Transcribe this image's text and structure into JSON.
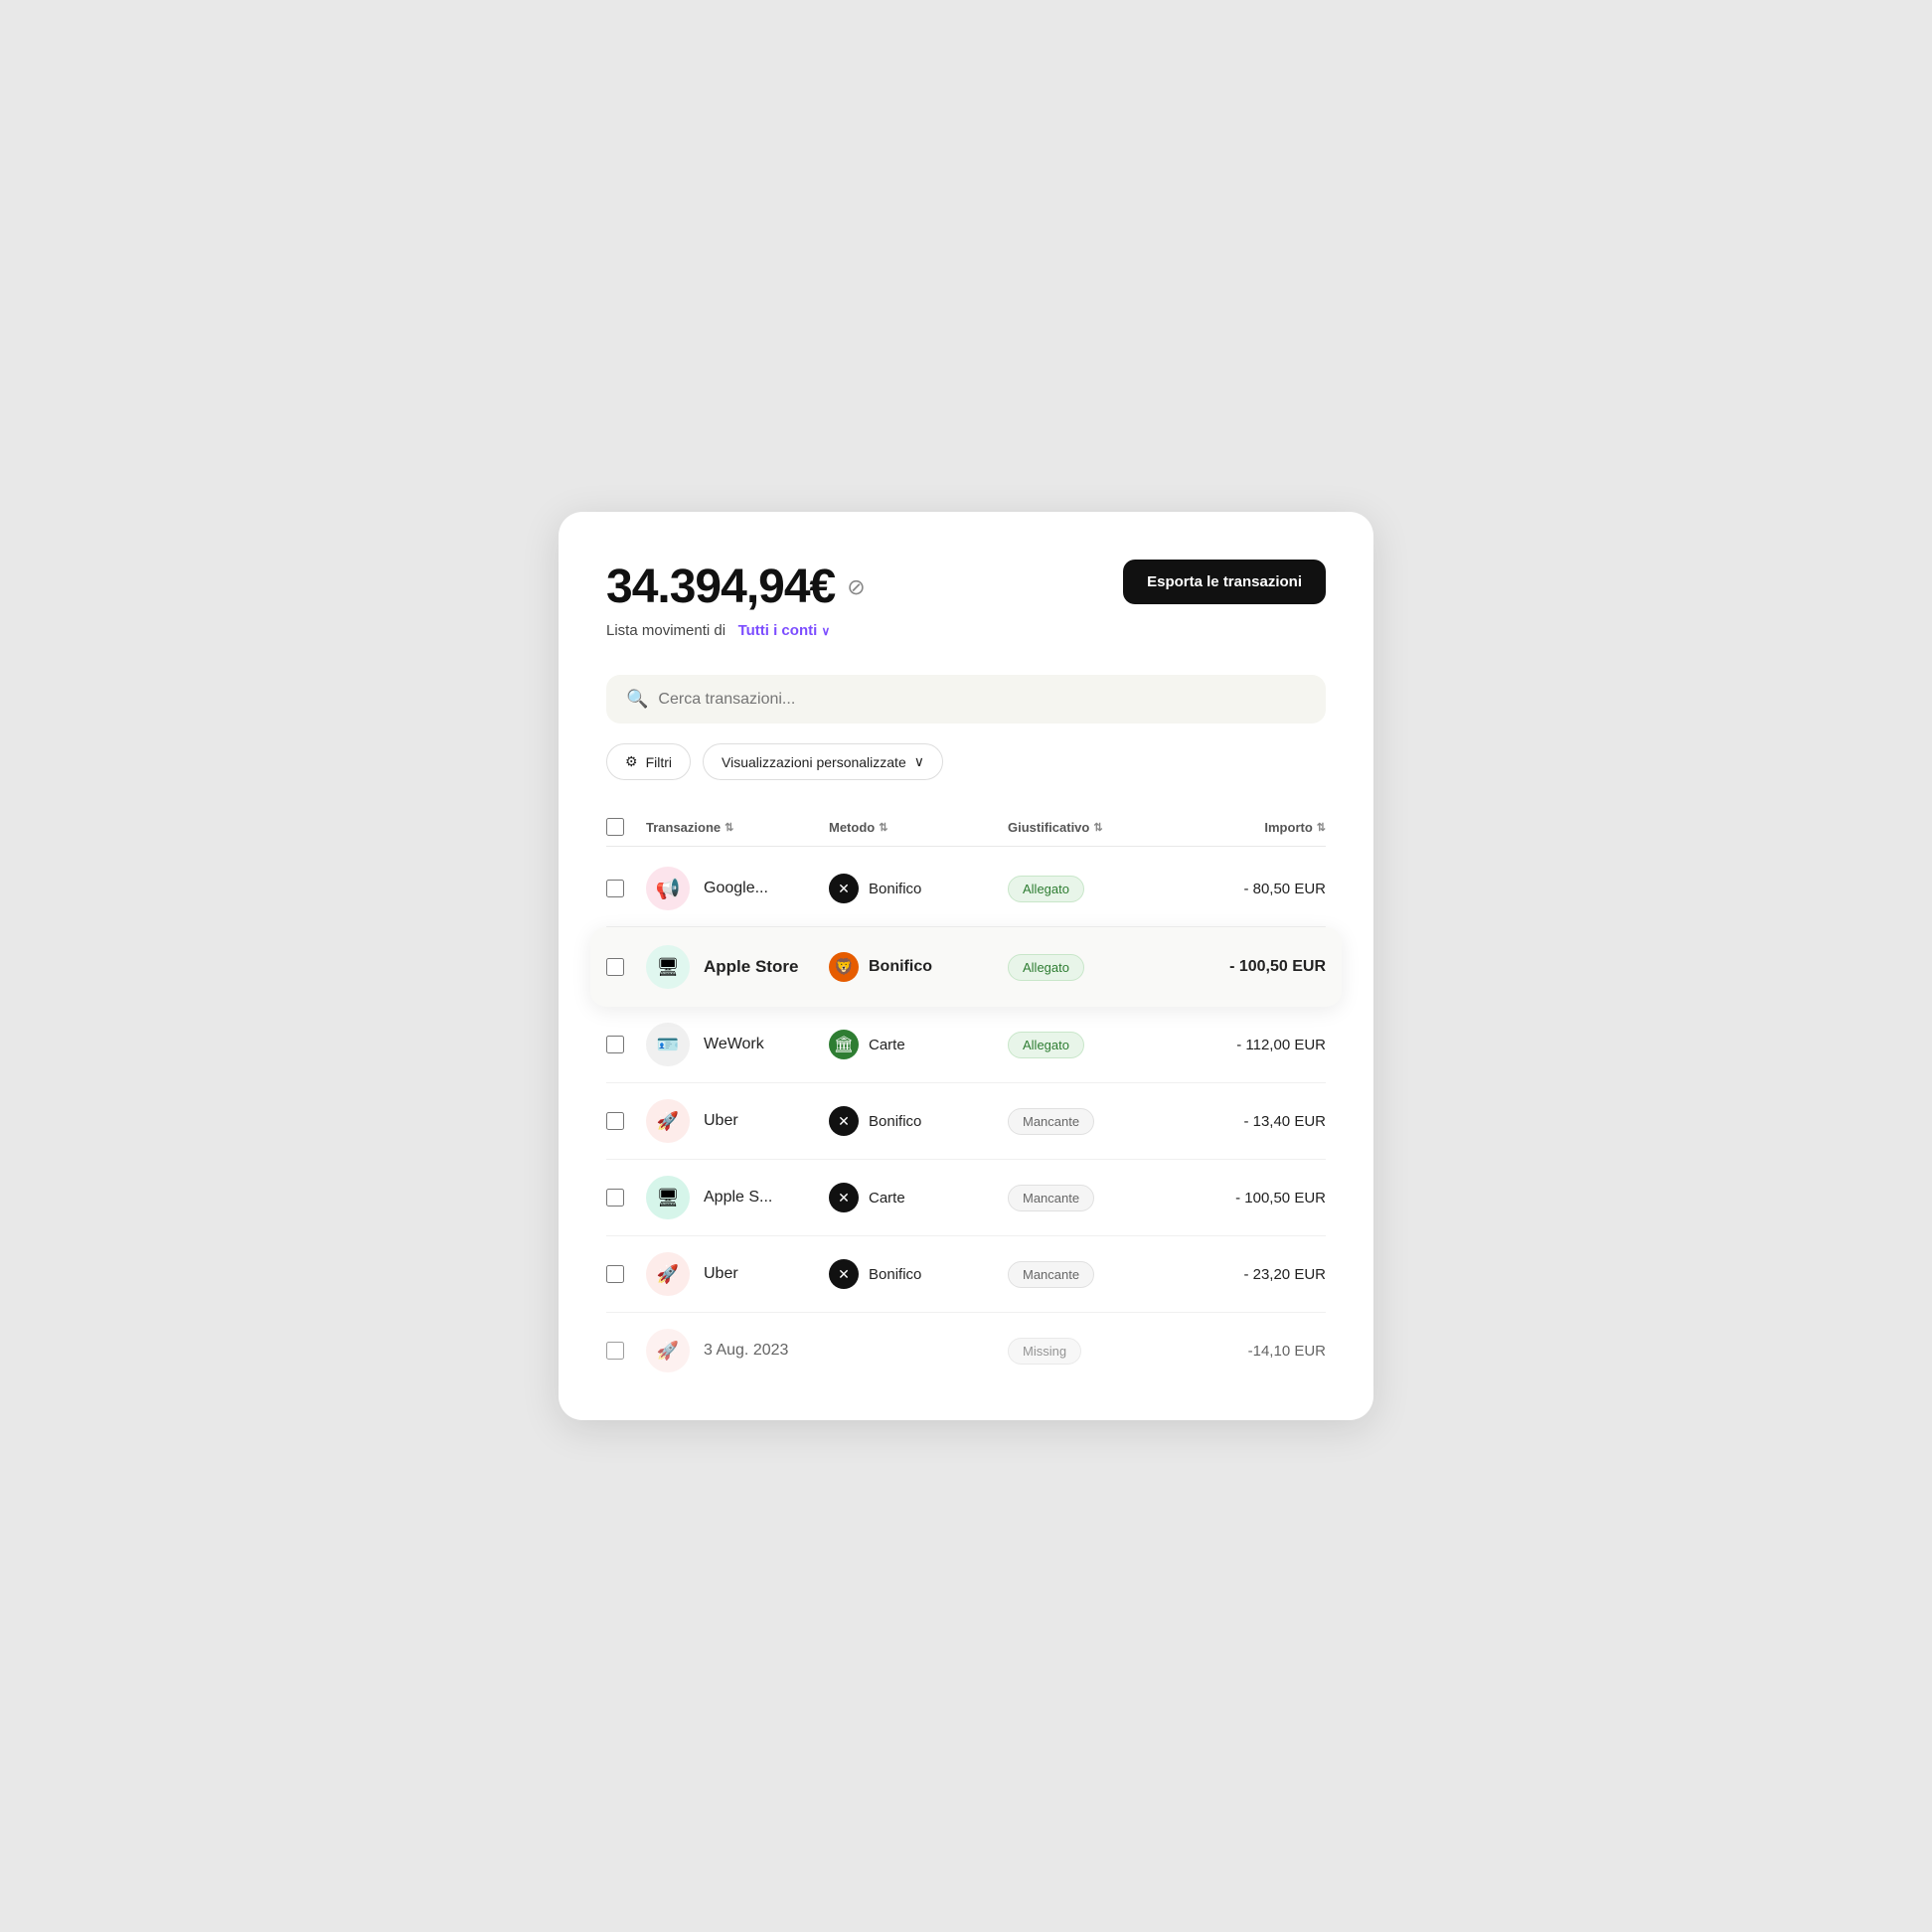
{
  "header": {
    "balance": "34.394,94€",
    "hide_icon": "⊘",
    "subtitle_prefix": "Lista movimenti di",
    "accounts_link": "Tutti i conti",
    "export_button": "Esporta le transazioni"
  },
  "search": {
    "placeholder": "Cerca transazioni..."
  },
  "filters": {
    "filter_button": "Filtri",
    "views_button": "Visualizzazioni personalizzate"
  },
  "table": {
    "columns": {
      "transazione": "Transazione",
      "metodo": "Metodo",
      "giustificativo": "Giustificativo",
      "importo": "Importo"
    },
    "rows": [
      {
        "name": "Google...",
        "icon_bg": "pink",
        "icon": "📢",
        "method": "Bonifico",
        "method_icon_type": "black",
        "method_icon": "✕",
        "badge": "Allegato",
        "badge_type": "allegato",
        "amount": "- 80,50 EUR",
        "highlighted": false
      },
      {
        "name": "Apple Store",
        "icon_bg": "mint",
        "icon": "🖥",
        "method": "Bonifico",
        "method_icon_type": "orange",
        "method_icon": "🦁",
        "badge": "Allegato",
        "badge_type": "allegato",
        "amount": "- 100,50 EUR",
        "highlighted": true
      },
      {
        "name": "WeWork",
        "icon_bg": "none",
        "icon": "🪪",
        "method": "Carte",
        "method_icon_type": "green",
        "method_icon": "🏛",
        "badge": "Allegato",
        "badge_type": "allegato",
        "amount": "- 112,00 EUR",
        "highlighted": false
      },
      {
        "name": "Uber",
        "icon_bg": "peach",
        "icon": "🚀",
        "method": "Bonifico",
        "method_icon_type": "black",
        "method_icon": "✕",
        "badge": "Mancante",
        "badge_type": "mancante",
        "amount": "- 13,40 EUR",
        "highlighted": false
      },
      {
        "name": "Apple S...",
        "icon_bg": "light-mint",
        "icon": "🖥",
        "method": "Carte",
        "method_icon_type": "black",
        "method_icon": "✕",
        "badge": "Mancante",
        "badge_type": "mancante",
        "amount": "- 100,50 EUR",
        "highlighted": false
      },
      {
        "name": "Uber",
        "icon_bg": "peach",
        "icon": "🚀",
        "method": "Bonifico",
        "method_icon_type": "black",
        "method_icon": "✕",
        "badge": "Mancante",
        "badge_type": "mancante",
        "amount": "- 23,20 EUR",
        "highlighted": false
      },
      {
        "name": "3 Aug. 2023",
        "icon_bg": "peach",
        "icon": "🚀",
        "method": "",
        "method_icon_type": "black",
        "method_icon": "",
        "badge": "Missing",
        "badge_type": "mancante",
        "amount": "-14,10 EUR",
        "highlighted": false,
        "partial": true
      }
    ]
  }
}
